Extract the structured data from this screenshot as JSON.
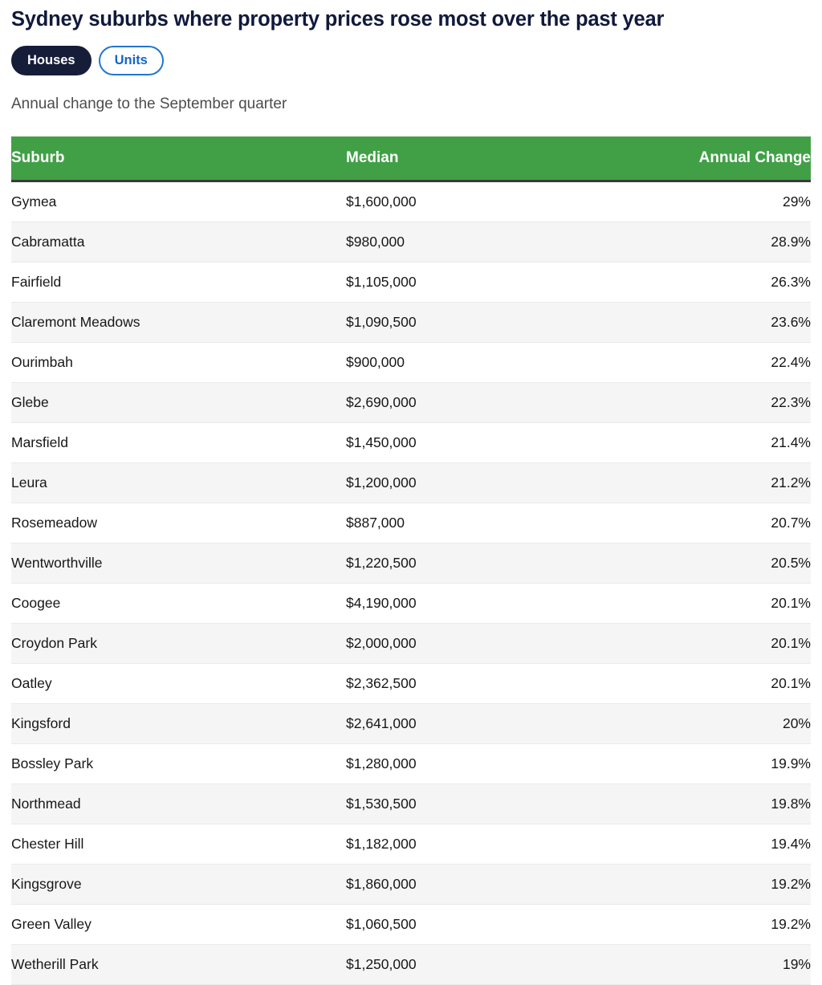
{
  "header": {
    "title": "Sydney suburbs where property prices rose most over the past year",
    "subtitle": "Annual change to the September quarter"
  },
  "toggle": {
    "options": [
      {
        "label": "Houses",
        "active": true
      },
      {
        "label": "Units",
        "active": false
      }
    ]
  },
  "colors": {
    "table_header_green": "#41a046",
    "pill_active_bg": "#151d39",
    "pill_inactive_border": "#2176ce",
    "pill_inactive_text": "#1565c7",
    "title_text": "#11193b",
    "subtitle_text": "#4d4d4d",
    "row_stripe": "#f5f5f5"
  },
  "table": {
    "columns": [
      "Suburb",
      "Median",
      "Annual Change"
    ],
    "rows": [
      {
        "suburb": "Gymea",
        "median": "$1,600,000",
        "change": "29%"
      },
      {
        "suburb": "Cabramatta",
        "median": "$980,000",
        "change": "28.9%"
      },
      {
        "suburb": "Fairfield",
        "median": "$1,105,000",
        "change": "26.3%"
      },
      {
        "suburb": "Claremont Meadows",
        "median": "$1,090,500",
        "change": "23.6%"
      },
      {
        "suburb": "Ourimbah",
        "median": "$900,000",
        "change": "22.4%"
      },
      {
        "suburb": "Glebe",
        "median": "$2,690,000",
        "change": "22.3%"
      },
      {
        "suburb": "Marsfield",
        "median": "$1,450,000",
        "change": "21.4%"
      },
      {
        "suburb": "Leura",
        "median": "$1,200,000",
        "change": "21.2%"
      },
      {
        "suburb": "Rosemeadow",
        "median": "$887,000",
        "change": "20.7%"
      },
      {
        "suburb": "Wentworthville",
        "median": "$1,220,500",
        "change": "20.5%"
      },
      {
        "suburb": "Coogee",
        "median": "$4,190,000",
        "change": "20.1%"
      },
      {
        "suburb": "Croydon Park",
        "median": "$2,000,000",
        "change": "20.1%"
      },
      {
        "suburb": "Oatley",
        "median": "$2,362,500",
        "change": "20.1%"
      },
      {
        "suburb": "Kingsford",
        "median": "$2,641,000",
        "change": "20%"
      },
      {
        "suburb": "Bossley Park",
        "median": "$1,280,000",
        "change": "19.9%"
      },
      {
        "suburb": "Northmead",
        "median": "$1,530,500",
        "change": "19.8%"
      },
      {
        "suburb": "Chester Hill",
        "median": "$1,182,000",
        "change": "19.4%"
      },
      {
        "suburb": "Kingsgrove",
        "median": "$1,860,000",
        "change": "19.2%"
      },
      {
        "suburb": "Green Valley",
        "median": "$1,060,500",
        "change": "19.2%"
      },
      {
        "suburb": "Wetherill Park",
        "median": "$1,250,000",
        "change": "19%"
      }
    ]
  },
  "chart_data": {
    "type": "table",
    "title": "Sydney suburbs where property prices rose most over the past year",
    "subtitle": "Annual change to the September quarter",
    "columns": [
      "Suburb",
      "Median",
      "Annual Change"
    ],
    "categories": [
      "Gymea",
      "Cabramatta",
      "Fairfield",
      "Claremont Meadows",
      "Ourimbah",
      "Glebe",
      "Marsfield",
      "Leura",
      "Rosemeadow",
      "Wentworthville",
      "Coogee",
      "Croydon Park",
      "Oatley",
      "Kingsford",
      "Bossley Park",
      "Northmead",
      "Chester Hill",
      "Kingsgrove",
      "Green Valley",
      "Wetherill Park"
    ],
    "series": [
      {
        "name": "Median",
        "values": [
          1600000,
          980000,
          1105000,
          1090500,
          900000,
          2690000,
          1450000,
          1200000,
          887000,
          1220500,
          4190000,
          2000000,
          2362500,
          2641000,
          1280000,
          1530500,
          1182000,
          1860000,
          1060500,
          1250000
        ]
      },
      {
        "name": "Annual Change",
        "values": [
          29,
          28.9,
          26.3,
          23.6,
          22.4,
          22.3,
          21.4,
          21.2,
          20.7,
          20.5,
          20.1,
          20.1,
          20.1,
          20,
          19.9,
          19.8,
          19.4,
          19.2,
          19.2,
          19
        ]
      }
    ],
    "xlabel": "",
    "ylabel": "",
    "legend": [
      "Houses",
      "Units"
    ]
  }
}
